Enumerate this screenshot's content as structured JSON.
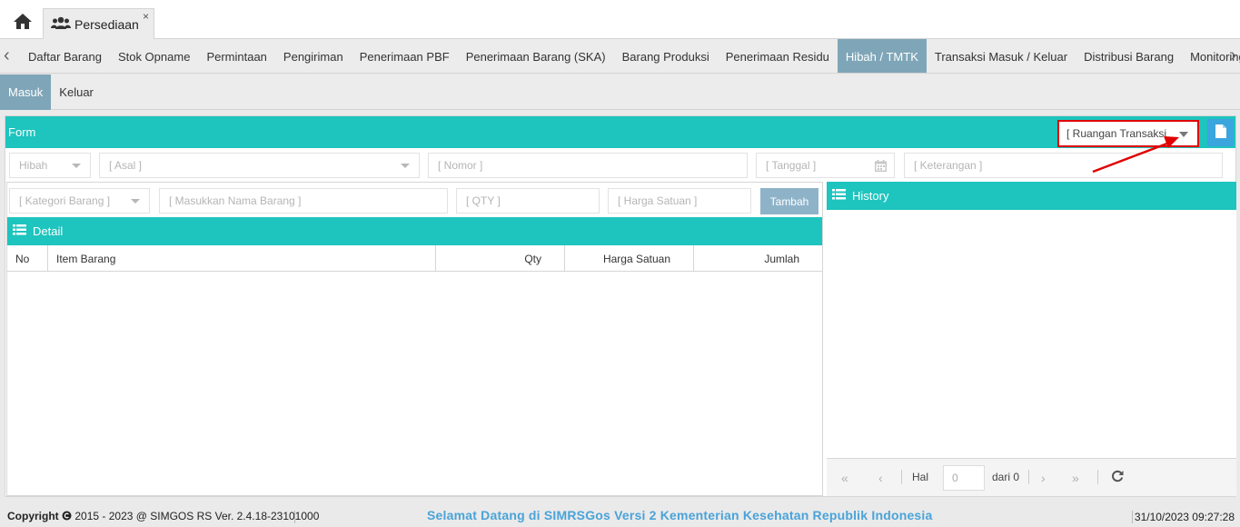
{
  "app_tab": {
    "label": "Persediaan",
    "close": "×"
  },
  "menu": {
    "items": [
      "Daftar Barang",
      "Stok Opname",
      "Permintaan",
      "Pengiriman",
      "Penerimaan PBF",
      "Penerimaan Barang (SKA)",
      "Barang Produksi",
      "Penerimaan Residu",
      "Hibah / TMTK",
      "Transaksi Masuk / Keluar",
      "Distribusi Barang",
      "Monitoring",
      "Moni"
    ],
    "active": "Hibah / TMTK"
  },
  "subtabs": {
    "items": [
      "Masuk",
      "Keluar"
    ],
    "active": "Masuk"
  },
  "form": {
    "title": "Form",
    "ruangan_placeholder": "[ Ruangan Transaksi ",
    "jenis": "Hibah",
    "asal_placeholder": "[ Asal ]",
    "nomor_placeholder": "[ Nomor ]",
    "tanggal_placeholder": "[ Tanggal ]",
    "keterangan_placeholder": "[ Keterangan ]",
    "kategori_placeholder": "[ Kategori Barang ]",
    "nama_placeholder": "[ Masukkan Nama Barang ]",
    "qty_placeholder": "[ QTY ]",
    "harga_placeholder": "[ Harga Satuan ]",
    "tambah_label": "Tambah"
  },
  "detail": {
    "title": "Detail",
    "columns": [
      "No",
      "Item Barang",
      "Qty",
      "Harga Satuan",
      "Jumlah"
    ]
  },
  "history": {
    "title": "History",
    "pager": {
      "page_label": "Hal",
      "page_value": "0",
      "of_label": "dari 0"
    }
  },
  "footer": {
    "copyright_label": "Copyright",
    "copyright_text": " 2015 - 2023 @ SIMGOS RS Ver. 2.4.18-23101000",
    "welcome": "Selamat Datang di SIMRSGos Versi 2 Kementerian Kesehatan Republik Indonesia",
    "datetime": "31/10/2023 09:27:28"
  },
  "colors": {
    "teal": "#1ec4be",
    "active_tab": "#7fa6b8",
    "button_blue": "#3ba5dd",
    "annotation_red": "#e00000"
  }
}
